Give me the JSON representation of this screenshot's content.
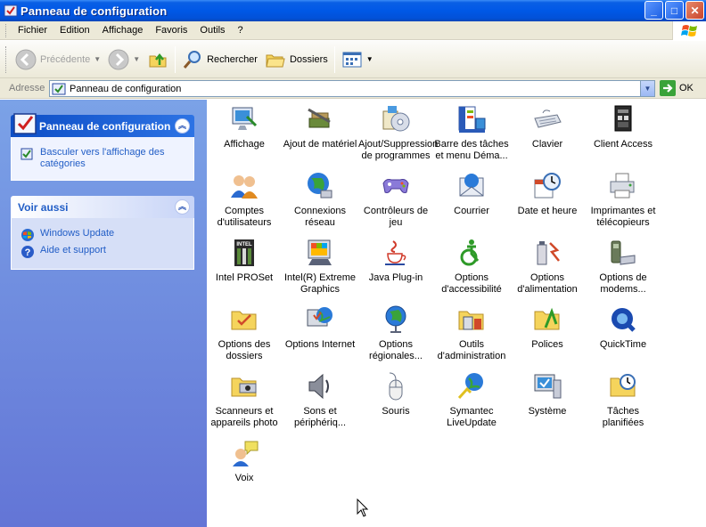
{
  "window": {
    "title": "Panneau de configuration",
    "buttons": [
      "_",
      "□",
      "✕"
    ]
  },
  "menu": [
    "Fichier",
    "Edition",
    "Affichage",
    "Favoris",
    "Outils",
    "?"
  ],
  "toolbar": {
    "back": "Précédente",
    "search": "Rechercher",
    "folders": "Dossiers"
  },
  "address": {
    "label": "Adresse",
    "value": "Panneau de configuration",
    "go": "OK"
  },
  "sidebar": {
    "panel_title": "Panneau de configuration",
    "panel_link": "Basculer vers l'affichage des catégories",
    "see_also_title": "Voir aussi",
    "see_also": [
      {
        "label": "Windows Update",
        "icon": "windows-update-icon"
      },
      {
        "label": "Aide et support",
        "icon": "help-icon"
      }
    ]
  },
  "items": [
    {
      "label": "Affichage",
      "icon": "display-icon"
    },
    {
      "label": "Ajout de matériel",
      "icon": "hardware-icon"
    },
    {
      "label": "Ajout/Suppression de programmes",
      "icon": "programs-icon"
    },
    {
      "label": "Barre des tâches et menu Déma...",
      "icon": "taskbar-icon"
    },
    {
      "label": "Clavier",
      "icon": "keyboard-icon"
    },
    {
      "label": "Client Access",
      "icon": "client-access-icon"
    },
    {
      "label": "Comptes d'utilisateurs",
      "icon": "users-icon"
    },
    {
      "label": "Connexions réseau",
      "icon": "network-icon"
    },
    {
      "label": "Contrôleurs de jeu",
      "icon": "gamepad-icon"
    },
    {
      "label": "Courrier",
      "icon": "mail-icon"
    },
    {
      "label": "Date et heure",
      "icon": "clock-icon"
    },
    {
      "label": "Imprimantes et télécopieurs",
      "icon": "printer-icon"
    },
    {
      "label": "Intel PROSet",
      "icon": "intel-icon"
    },
    {
      "label": "Intel(R) Extreme Graphics",
      "icon": "graphics-icon"
    },
    {
      "label": "Java Plug-in",
      "icon": "java-icon"
    },
    {
      "label": "Options d'accessibilité",
      "icon": "accessibility-icon"
    },
    {
      "label": "Options d'alimentation",
      "icon": "power-icon"
    },
    {
      "label": "Options de modems...",
      "icon": "modem-icon"
    },
    {
      "label": "Options des dossiers",
      "icon": "folder-options-icon"
    },
    {
      "label": "Options Internet",
      "icon": "internet-icon"
    },
    {
      "label": "Options régionales...",
      "icon": "globe-icon"
    },
    {
      "label": "Outils d'administration",
      "icon": "admin-tools-icon"
    },
    {
      "label": "Polices",
      "icon": "fonts-icon"
    },
    {
      "label": "QuickTime",
      "icon": "quicktime-icon"
    },
    {
      "label": "Scanneurs et appareils photo",
      "icon": "scanner-icon"
    },
    {
      "label": "Sons et périphériq...",
      "icon": "sound-icon"
    },
    {
      "label": "Souris",
      "icon": "mouse-icon"
    },
    {
      "label": "Symantec LiveUpdate",
      "icon": "liveupdate-icon"
    },
    {
      "label": "Système",
      "icon": "system-icon"
    },
    {
      "label": "Tâches planifiées",
      "icon": "scheduled-tasks-icon"
    },
    {
      "label": "Voix",
      "icon": "speech-icon"
    }
  ]
}
